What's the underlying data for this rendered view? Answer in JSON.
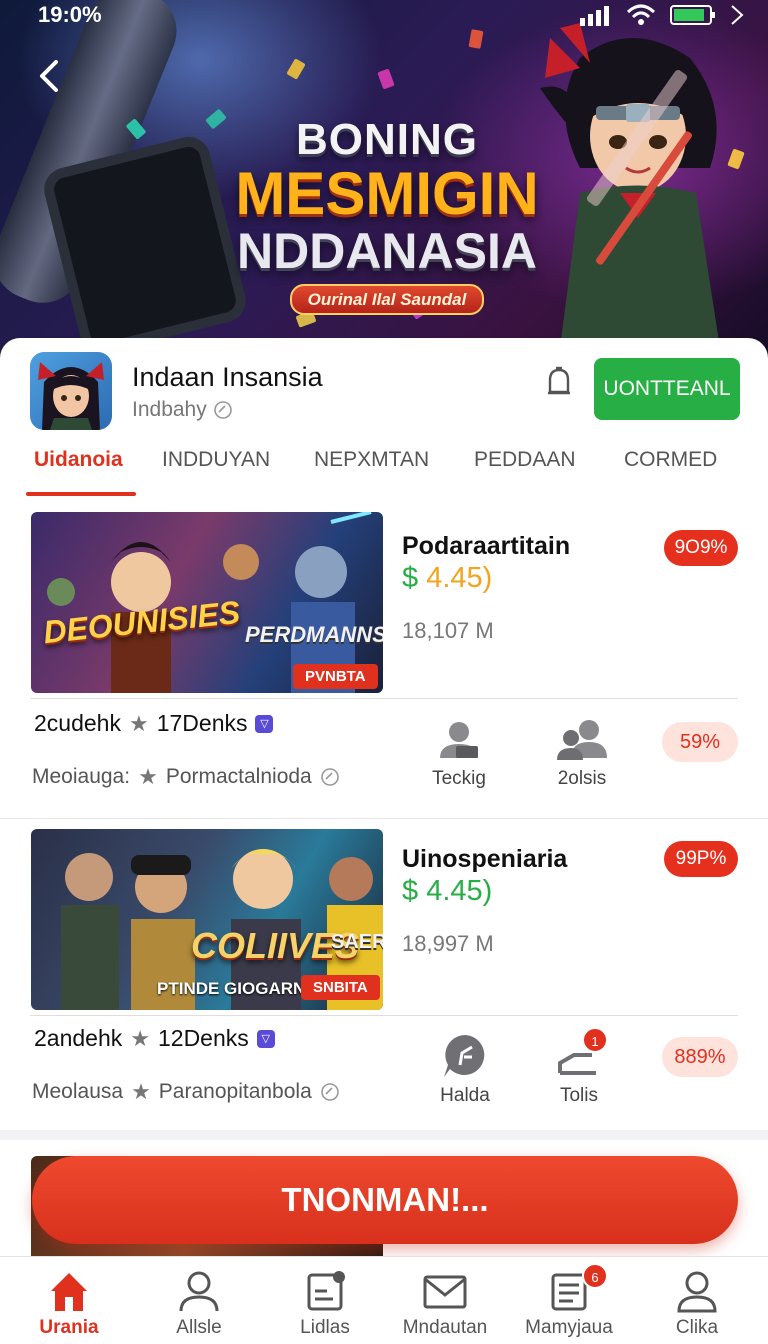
{
  "status_bar": {
    "time": "19:0%"
  },
  "hero": {
    "title_line1": "BONING",
    "title_line2": "MESMIGIN",
    "title_line3": "NDDANASIA",
    "subtitle": "Ourinal Ilal Saundal"
  },
  "app": {
    "name": "Indaan Insansia",
    "developer": "Indbahy",
    "download_label": "UONTTEANL",
    "bell_icon": "bell-icon"
  },
  "tabs": [
    {
      "label": "Uidanoia",
      "active": true
    },
    {
      "label": "INDDUYAN"
    },
    {
      "label": "NEPXMTAN"
    },
    {
      "label": "PEDDAAN"
    },
    {
      "label": "CORMED"
    }
  ],
  "items": [
    {
      "thumb_text": "DEOUNISIES",
      "thumb_text2": "PERDMANNS",
      "thumb_badge": "PVNBTA",
      "title": "Podaraartitain",
      "price_symbol": "$",
      "price_value": "4.45)",
      "size": "18,107 M",
      "sale": "9O9%",
      "meta_name": "2cudehk",
      "meta_rating": "17Denks",
      "meta_label": "Meoiauga:",
      "meta_tag": "Pormactalnioda",
      "actions": [
        {
          "label": "Teckig",
          "icon": "user-card-icon"
        },
        {
          "label": "2olsis",
          "icon": "users-icon"
        }
      ],
      "pct": "59%"
    },
    {
      "thumb_text": "COLIIVES",
      "thumb_text2": "SAER",
      "thumb_caption": "PTINDE GIOGARN",
      "thumb_badge": "SNBITA",
      "title": "Uinospeniaria",
      "price_symbol": "$",
      "price_value": "4.45)",
      "size": "18,997 M",
      "sale": "99P%",
      "meta_name": "2andehk",
      "meta_rating": "12Denks",
      "meta_label": "Meolausa",
      "meta_tag": "Paranopitanbola",
      "actions": [
        {
          "label": "Halda",
          "icon": "share-bubble-icon"
        },
        {
          "label": "Tolis",
          "icon": "reply-icon",
          "badge": "1"
        }
      ],
      "pct": "889%"
    }
  ],
  "cta": {
    "label": "TNONMAN!..."
  },
  "bottom_nav": [
    {
      "label": "Urania",
      "icon": "home-icon",
      "active": true
    },
    {
      "label": "Allsle",
      "icon": "person-icon"
    },
    {
      "label": "Lidlas",
      "icon": "list-card-icon"
    },
    {
      "label": "Mndautan",
      "icon": "mail-icon"
    },
    {
      "label": "Mamyjaua",
      "icon": "inbox-icon",
      "badge": "6"
    },
    {
      "label": "Clika",
      "icon": "profile-icon"
    }
  ]
}
